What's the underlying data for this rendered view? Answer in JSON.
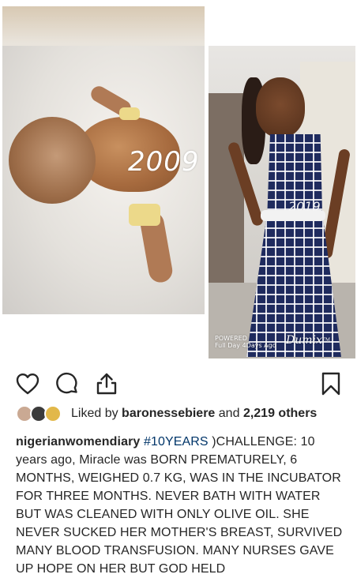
{
  "post": {
    "photo_left": {
      "year_label": "2009"
    },
    "photo_right": {
      "year_label": "2019",
      "watermark_left_line1": "POWERED",
      "watermark_left_line2": "Full Day 4Days Ago",
      "watermark_right": "Dumix",
      "watermark_right_tag": "TM"
    }
  },
  "actions": {
    "like_icon": "heart-outline-icon",
    "comment_icon": "comment-bubble-icon",
    "share_icon": "share-upload-icon",
    "save_icon": "bookmark-outline-icon"
  },
  "likes": {
    "prefix": "Liked by",
    "user": "baronessebiere",
    "connector": "and",
    "others": "2,219 others",
    "avatar_colors": [
      "#caa993",
      "#3b3b3b",
      "#e2b84a"
    ]
  },
  "caption": {
    "username": "nigerianwomendiary",
    "hashtag": "#10YEARS",
    "text": " )CHALLENGE: 10 years ago, Miracle was BORN PREMATURELY, 6 MONTHS, WEIGHED 0.7 KG, WAS IN THE INCUBATOR FOR THREE MONTHS. NEVER BATH WITH WATER BUT WAS CLEANED WITH ONLY OLIVE OIL. SHE NEVER SUCKED HER MOTHER'S BREAST, SURVIVED MANY BLOOD TRANSFUSION. MANY NURSES GAVE UP HOPE ON HER BUT GOD HELD"
  },
  "colors": {
    "text": "#262626",
    "hashtag": "#003569",
    "icon": "#262626"
  }
}
